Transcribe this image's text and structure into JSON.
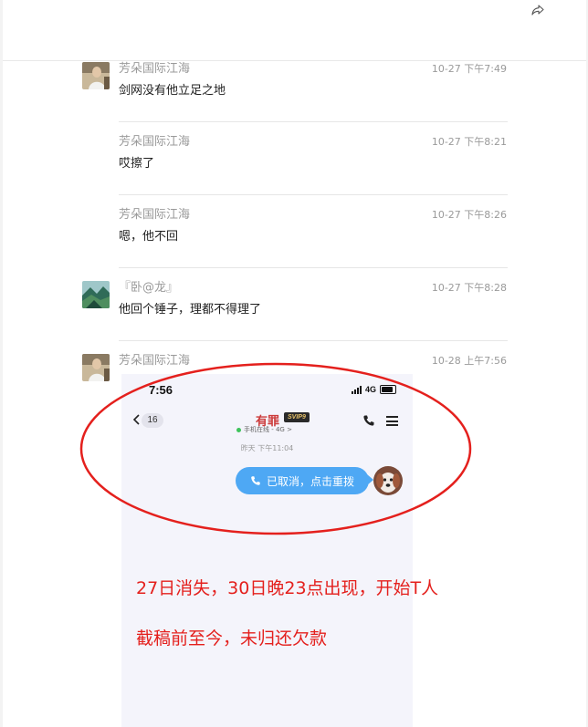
{
  "toolbar": {
    "share_icon": "share-forward-icon"
  },
  "messages": [
    {
      "sender": "芳朵国际江海",
      "time": "10-27 下午7:49",
      "content": "剑网没有他立足之地",
      "avatar": "photo-avatar"
    },
    {
      "sender": "芳朵国际江海",
      "time": "10-27 下午8:21",
      "content": "哎擦了"
    },
    {
      "sender": "芳朵国际江海",
      "time": "10-27 下午8:26",
      "content": "嗯，他不回"
    },
    {
      "sender": "『卧@龙』",
      "time": "10-27 下午8:28",
      "content": "他回个锤子，理都不得理了",
      "avatar": "landscape-avatar"
    },
    {
      "sender": "芳朵国际江海",
      "time": "10-28 上午7:56",
      "avatar": "photo-avatar"
    }
  ],
  "phone": {
    "status_time": "7:56",
    "network": "4G",
    "back_count": "16",
    "contact_name": "有罪",
    "vip_badge": "SVIP9",
    "online_status": "手机在线 - 4G >",
    "chat_timestamp": "昨天 下午11:04",
    "bubble_text": "已取消，点击重拨"
  },
  "annotations": {
    "line1": "27日消失，30日晚23点出现，开始T人",
    "line2": "截稿前至今，未归还欠款"
  },
  "colors": {
    "annotation_red": "#e4201d",
    "bubble_blue": "#4ea8f4",
    "name_red": "#cc3b3b"
  }
}
